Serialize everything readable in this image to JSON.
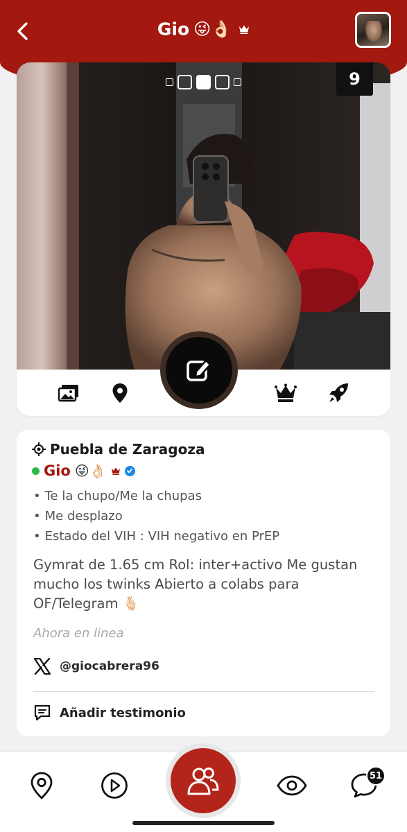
{
  "header": {
    "title": "Gio",
    "title_emojis": "😜👌🏻",
    "back_icon": "chevron-left-icon",
    "crown_icon": "crown-icon",
    "avatar_icon": "profile-thumbnail"
  },
  "gallery": {
    "photo_count": "9",
    "page_dots": 5,
    "active_dot": 2
  },
  "actions": {
    "photos_icon": "photos-icon",
    "location_icon": "map-pin-icon",
    "edit_icon": "edit-icon",
    "premium_icon": "crown-icon",
    "boost_icon": "rocket-icon"
  },
  "profile": {
    "location": "Puebla de Zaragoza",
    "name": "Gio",
    "name_emojis": "😜👌🏻",
    "bullets": [
      "Te la chupo/Me la chupas",
      "Me desplazo",
      "Estado del VIH : VIH negativo en PrEP"
    ],
    "bio": "Gymrat de 1.65 cm Rol: inter+activo Me gustan mucho los twinks Abierto a colabs para OF/Telegram 🫰🏻",
    "status": "Ahora en linea",
    "social_handle": "@giocabrera96",
    "testimonial_label": "Añadir testimonio"
  },
  "nav": {
    "items": [
      "map-pin-icon",
      "play-icon",
      "people-icon",
      "eye-icon",
      "chat-icon"
    ],
    "chat_badge": "51"
  },
  "colors": {
    "brand": "#a3180f",
    "online": "#2eb84a",
    "verified": "#1e88e5"
  }
}
